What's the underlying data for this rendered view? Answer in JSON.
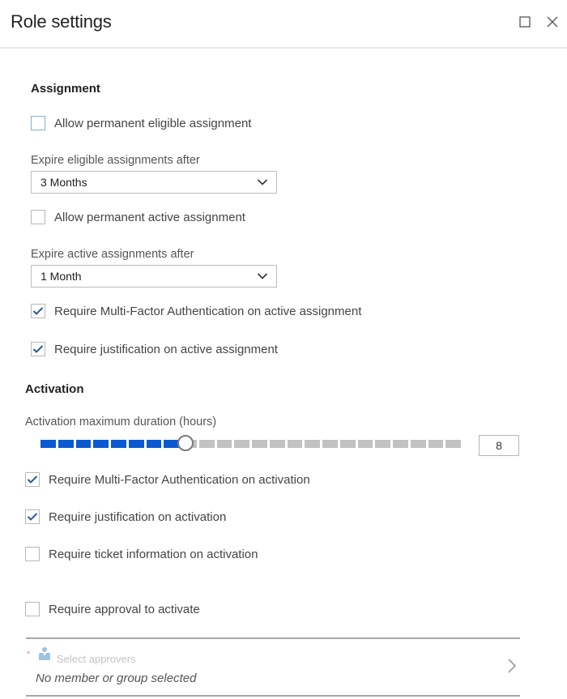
{
  "header": {
    "title": "Role settings",
    "maximize_icon": "maximize-icon",
    "close_icon": "close-icon"
  },
  "assignment": {
    "heading": "Assignment",
    "allow_permanent_eligible": {
      "label": "Allow permanent eligible assignment",
      "checked": false
    },
    "expire_eligible": {
      "label": "Expire eligible assignments after",
      "value": "3 Months"
    },
    "allow_permanent_active": {
      "label": "Allow permanent active assignment",
      "checked": false
    },
    "expire_active": {
      "label": "Expire active assignments after",
      "value": "1 Month"
    },
    "require_mfa_active": {
      "label": "Require Multi-Factor Authentication on active assignment",
      "checked": true
    },
    "require_justification_active": {
      "label": "Require justification on active assignment",
      "checked": true
    }
  },
  "activation": {
    "heading": "Activation",
    "max_duration": {
      "label": "Activation maximum duration (hours)",
      "value": 8,
      "min": 0,
      "max": 24,
      "value_text": "8"
    },
    "require_mfa": {
      "label": "Require Multi-Factor Authentication on activation",
      "checked": true
    },
    "require_justification": {
      "label": "Require justification on activation",
      "checked": true
    },
    "require_ticket": {
      "label": "Require ticket information on activation",
      "checked": false
    },
    "require_approval": {
      "label": "Require approval to activate",
      "checked": false
    }
  },
  "approvers": {
    "required_marker": "*",
    "icon": "person-icon",
    "label": "Select approvers",
    "value": "No member or group selected",
    "chevron_icon": "chevron-right-icon"
  },
  "colors": {
    "accent": "#0a5ad1",
    "checkmark": "#2b5797",
    "slider_off": "#c2c2c2"
  }
}
